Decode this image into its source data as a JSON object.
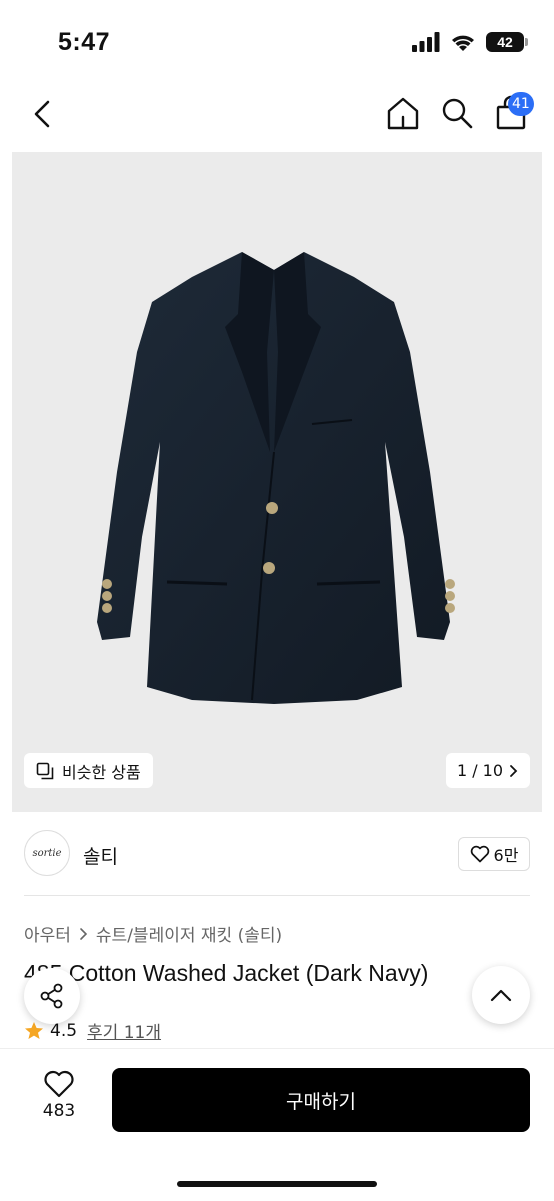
{
  "status": {
    "time": "5:47",
    "battery": "42"
  },
  "nav": {
    "cart_count": "41"
  },
  "product_image": {
    "similar_label": "비슷한 상품",
    "page_indicator": "1 / 10"
  },
  "brand": {
    "logo_text": "sortie",
    "name": "솔티",
    "like_count": "6만"
  },
  "breadcrumb": {
    "category": "아우터",
    "subcategory": "슈트/블레이저 재킷 (솔티)"
  },
  "product": {
    "title": "485 Cotton Washed Jacket (Dark Navy)",
    "rating": "4.5",
    "review_label": "후기 11개"
  },
  "bottom": {
    "wish_count": "483",
    "buy_label": "구매하기"
  },
  "colors": {
    "accent_badge": "#2b6ef6",
    "buy_button": "#000000",
    "star": "#f5a623"
  }
}
